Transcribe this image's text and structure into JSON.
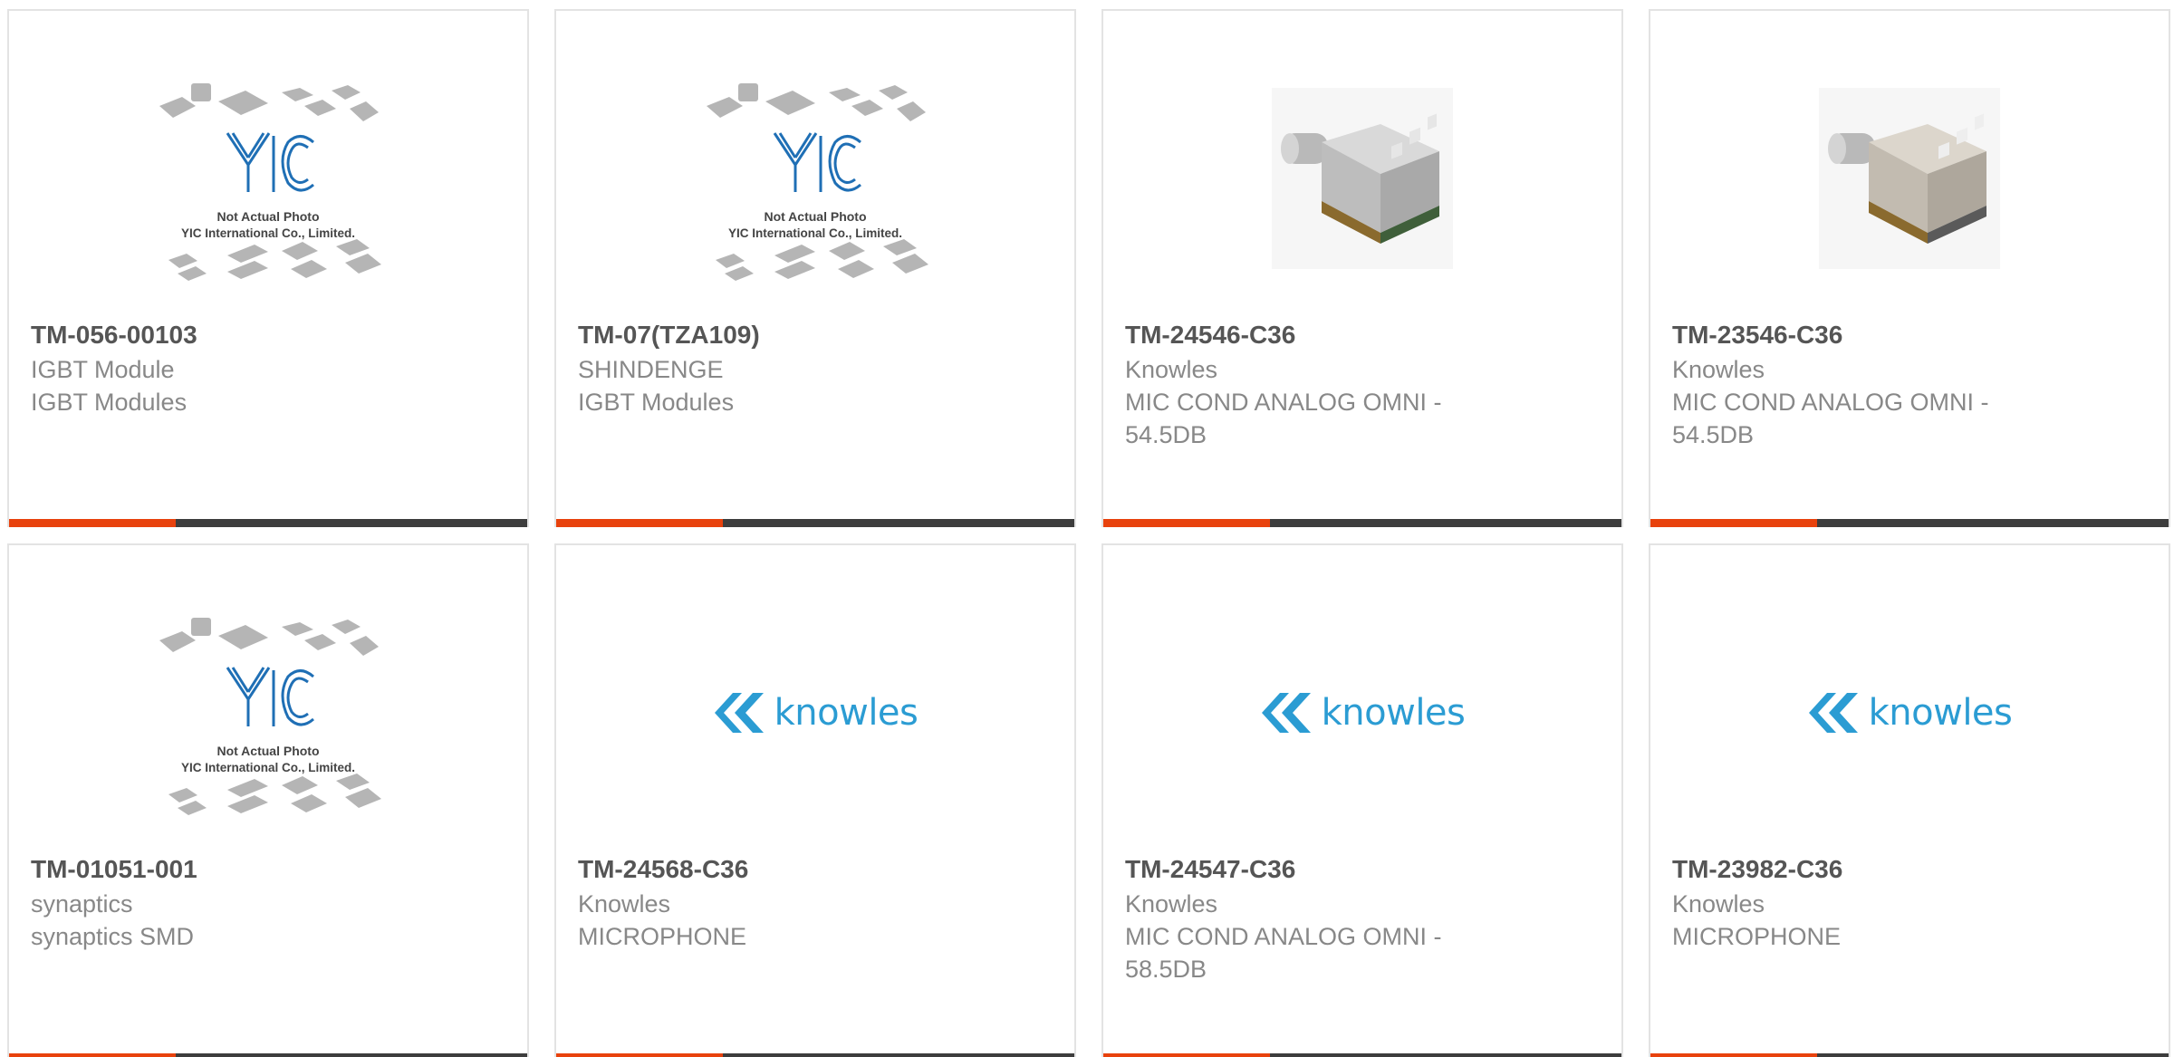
{
  "products": [
    {
      "part_number": "TM-056-00103",
      "manufacturer": "IGBT Module",
      "description": "IGBT Modules",
      "image": "yic-placeholder"
    },
    {
      "part_number": "TM-07(TZA109)",
      "manufacturer": "SHINDENGE",
      "description": "IGBT Modules",
      "image": "yic-placeholder"
    },
    {
      "part_number": "TM-24546-C36",
      "manufacturer": "Knowles",
      "description": "MIC COND ANALOG OMNI - 54.5DB",
      "image": "microphone-photo"
    },
    {
      "part_number": "TM-23546-C36",
      "manufacturer": "Knowles",
      "description": "MIC COND ANALOG OMNI - 54.5DB",
      "image": "microphone-photo"
    },
    {
      "part_number": "TM-01051-001",
      "manufacturer": "synaptics",
      "description": "synaptics SMD",
      "image": "yic-placeholder"
    },
    {
      "part_number": "TM-24568-C36",
      "manufacturer": "Knowles",
      "description": "MICROPHONE",
      "image": "knowles-logo"
    },
    {
      "part_number": "TM-24547-C36",
      "manufacturer": "Knowles",
      "description": "MIC COND ANALOG OMNI - 58.5DB",
      "image": "knowles-logo"
    },
    {
      "part_number": "TM-23982-C36",
      "manufacturer": "Knowles",
      "description": "MICROPHONE",
      "image": "knowles-logo"
    }
  ],
  "placeholder": {
    "logo_text": "YIC",
    "line1": "Not Actual Photo",
    "line2": "YIC International Co., Limited."
  },
  "knowles_logo": {
    "word": "knowles"
  },
  "colors": {
    "accent_bar": "#e8420d",
    "bar_dark": "#3d3d3d",
    "yic_blue": "#1f6fb5",
    "knowles_blue": "#2b9cd3"
  }
}
